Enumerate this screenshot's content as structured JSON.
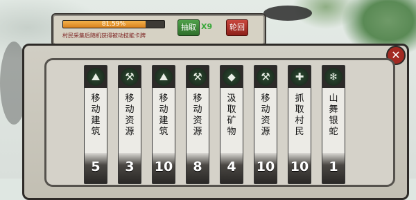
{
  "progress": {
    "percent_label": "81.59%",
    "value": 0.8159,
    "hint": "村民采集后随机获得被动技能卡牌"
  },
  "actions": {
    "extract_label": "抽取",
    "extract_count": "X9",
    "wheel_label": "轮回"
  },
  "close_icon": "close-icon",
  "cards": [
    {
      "icon": "build-icon",
      "glyph": "⛰",
      "label": "移动建筑",
      "count": "5"
    },
    {
      "icon": "harvest-icon",
      "glyph": "⚒",
      "label": "移动资源",
      "count": "3"
    },
    {
      "icon": "build-icon",
      "glyph": "⛰",
      "label": "移动建筑",
      "count": "10"
    },
    {
      "icon": "harvest-icon",
      "glyph": "⚒",
      "label": "移动资源",
      "count": "8"
    },
    {
      "icon": "ore-icon",
      "glyph": "◆",
      "label": "汲取矿物",
      "count": "4"
    },
    {
      "icon": "harvest-icon",
      "glyph": "⚒",
      "label": "移动资源",
      "count": "10"
    },
    {
      "icon": "capture-icon",
      "glyph": "✚",
      "label": "抓取村民",
      "count": "10"
    },
    {
      "icon": "snow-icon",
      "glyph": "❄",
      "label": "山舞银蛇",
      "count": "1"
    }
  ]
}
